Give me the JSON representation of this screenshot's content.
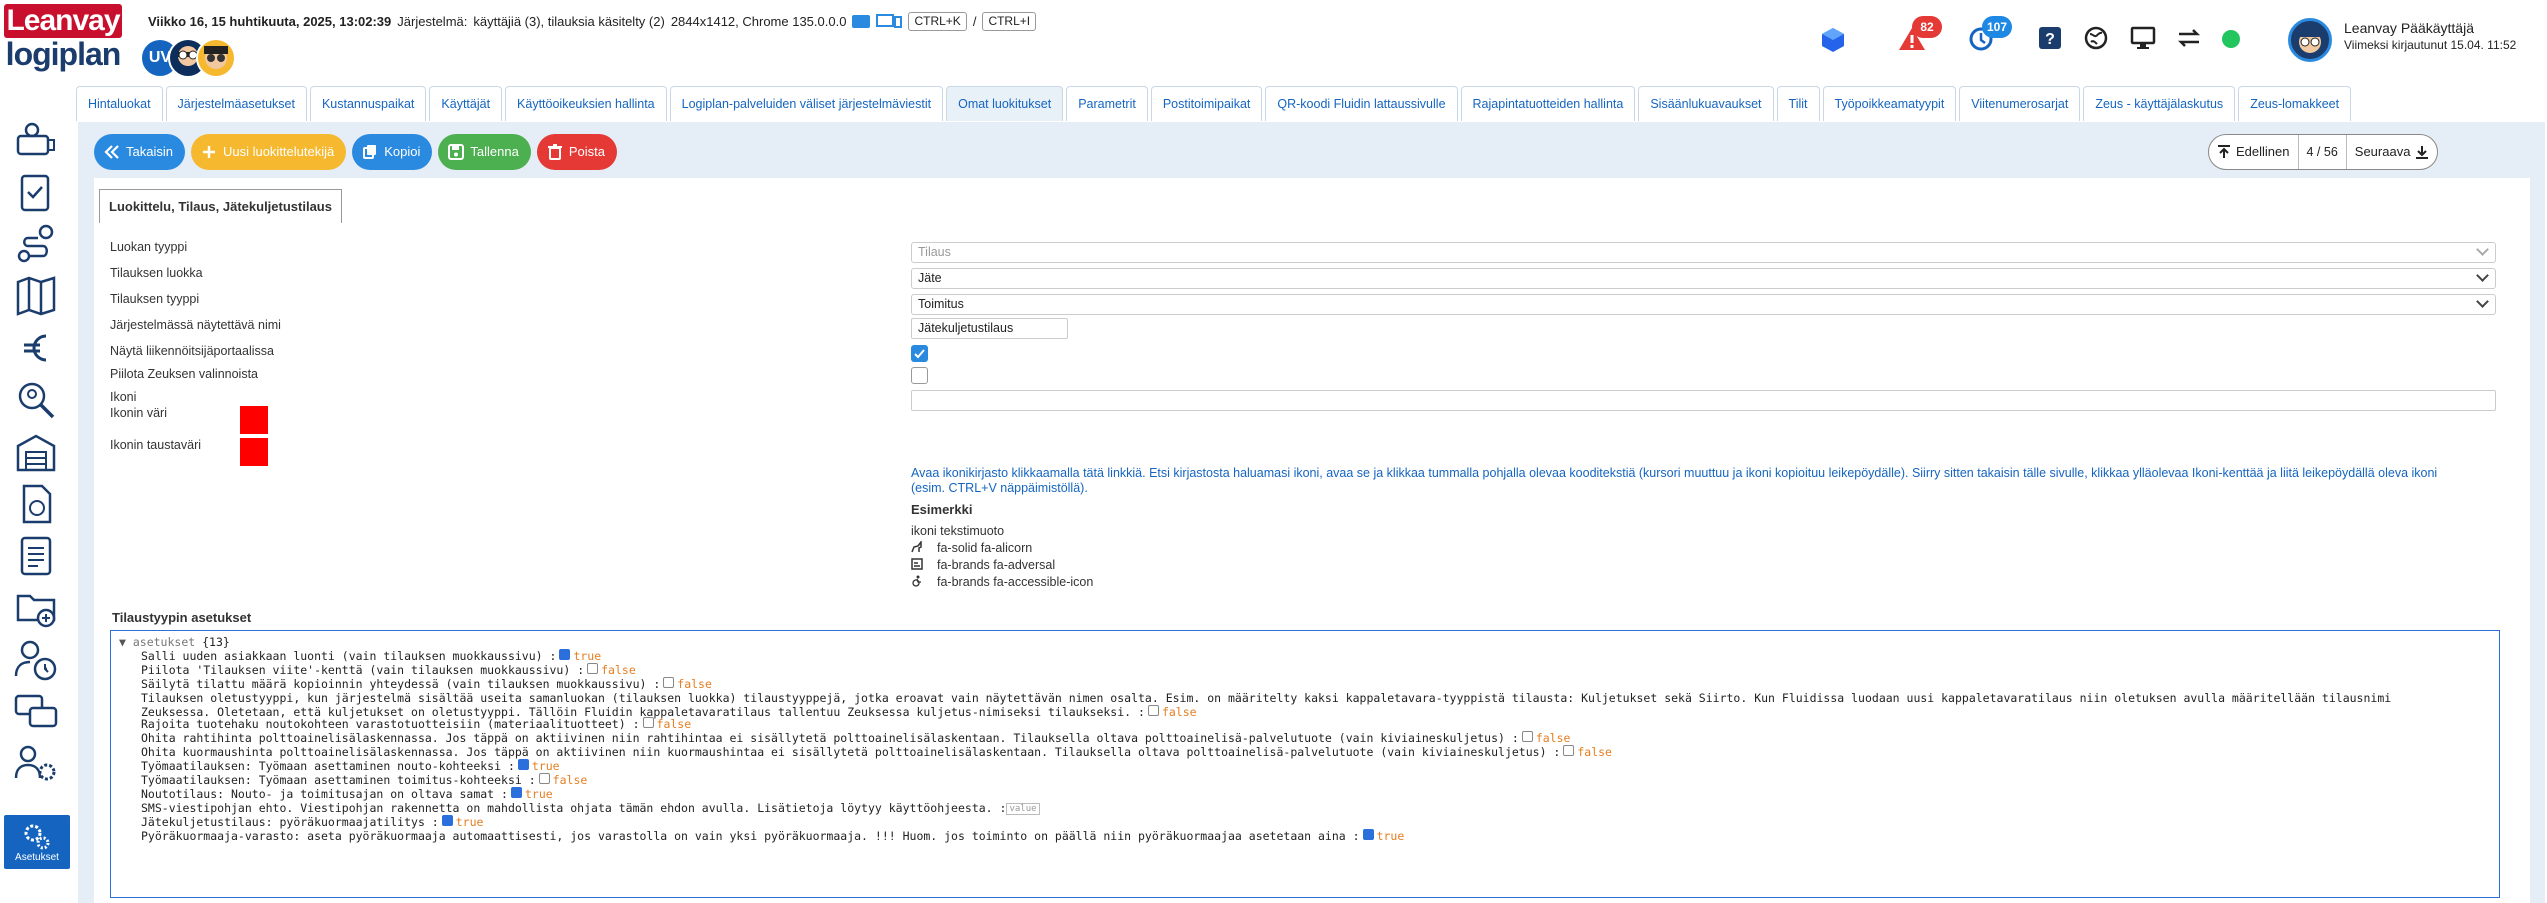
{
  "brand": {
    "top": "Leanvay",
    "bottom": "logiplan"
  },
  "status": {
    "week": "Viikko 16, 15 huhtikuuta, 2025, 13:02:39",
    "system_label": "Järjestelmä:",
    "system_value": "käyttäjiä (3), tilauksia käsitelty (2)",
    "resolution": "2844x1412, Chrome 135.0.0.0",
    "shortcut1": "CTRL+K",
    "sep": "/",
    "shortcut2": "CTRL+I"
  },
  "avatars": [
    {
      "initials": "UV"
    },
    {
      "initials": ""
    },
    {
      "initials": ""
    }
  ],
  "notifications": {
    "alerts": "82",
    "updates": "107"
  },
  "user": {
    "name": "Leanvay Pääkäyttäjä",
    "last_login": "Viimeksi kirjautunut 15.04. 11:52"
  },
  "sidebar": {
    "active_label": "Asetukset"
  },
  "tabs": [
    "Hintaluokat",
    "Järjestelmäasetukset",
    "Kustannuspaikat",
    "Käyttäjät",
    "Käyttöoikeuksien hallinta",
    "Logiplan-palveluiden väliset järjestelmäviestit",
    "Omat luokitukset",
    "Parametrit",
    "Postitoimipaikat",
    "QR-koodi Fluidin lattaussivulle",
    "Rajapintatuotteiden hallinta",
    "Sisäänlukuavaukset",
    "Tilit",
    "Työpoikkeamatyypit",
    "Viitenumerosarjat",
    "Zeus - käyttäjälaskutus",
    "Zeus-lomakkeet"
  ],
  "active_tab": "Omat luokitukset",
  "toolbar": {
    "back": "Takaisin",
    "new_classifier": "Uusi luokittelutekijä",
    "copy": "Kopioi",
    "save": "Tallenna",
    "delete": "Poista"
  },
  "pager": {
    "prev": "Edellinen",
    "count": "4 / 56",
    "next": "Seuraava"
  },
  "panel_tab": "Luokittelu, Tilaus, Jätekuljetustilaus",
  "form": {
    "class_type_label": "Luokan tyyppi",
    "class_type_value": "Tilaus",
    "order_class_label": "Tilauksen luokka",
    "order_class_value": "Jäte",
    "order_type_label": "Tilauksen tyyppi",
    "order_type_value": "Toimitus",
    "display_name_label": "Järjestelmässä näytettävä nimi",
    "display_name_value": "Jätekuljetustilaus",
    "show_portal_label": "Näytä liikennöitsijäportaalissa",
    "show_portal_checked": true,
    "hide_zeus_label": "Piilota Zeuksen valinnoista",
    "hide_zeus_checked": false,
    "icon_label": "Ikoni",
    "icon_value": "",
    "icon_color_label": "Ikonin väri",
    "icon_color": "#ff0000",
    "icon_bg_label": "Ikonin taustaväri",
    "icon_bg": "#ff0000",
    "help_text": "Avaa ikonikirjasto klikkaamalla tätä linkkiä. Etsi kirjastosta haluamasi ikoni, avaa se ja klikkaa tummalla pohjalla olevaa kooditekstiä (kursori muuttuu ja ikoni kopioituu leikepöydälle). Siirry sitten takaisin tälle sivulle, klikkaa ylläolevaa Ikoni-kenttää ja liitä leikepöydällä oleva ikoni (esim. CTRL+V näppäimistöllä).",
    "examples_heading": "Esimerkki",
    "examples_format": "ikoni tekstimuoto",
    "examples": [
      "fa-solid fa-alicorn",
      "fa-brands fa-adversal",
      "fa-brands fa-accessible-icon"
    ]
  },
  "settings": {
    "heading": "Tilaustyypin asetukset",
    "root_key": "asetukset",
    "root_count": "{13}",
    "rows": [
      {
        "text": "Salli uuden asiakkaan luonti (vain tilauksen muokkaussivu)",
        "value": "true",
        "checked": true
      },
      {
        "text": "Piilota 'Tilauksen viite'-kenttä (vain tilauksen muokkaussivu)",
        "value": "false",
        "checked": false
      },
      {
        "text": "Säilytä tilattu määrä kopioinnin yhteydessä (vain tilauksen muokkaussivu)",
        "value": "false",
        "checked": false
      },
      {
        "text": "Tilauksen oletustyyppi, kun järjestelmä sisältää useita samanluokan (tilauksen luokka) tilaustyyppejä, jotka eroavat vain näytettävän nimen osalta. Esim. on määritelty kaksi kappaletavara-tyyppistä tilausta: Kuljetukset sekä Siirto. Kun Fluidissa luodaan uusi kappaletavaratilaus niin oletuksen avulla määritellään tilausnimi\nZeuksessa. Oletetaan, että kuljetukset on oletustyyppi. Tällöin Fluidin kappaletavaratilaus tallentuu Zeuksessa kuljetus-nimiseksi tilaukseksi.",
        "value": "false",
        "checked": false
      },
      {
        "text": "Rajoita tuotehaku noutokohteen varastotuotteisiin (materiaalituotteet)",
        "value": "false",
        "checked": false
      },
      {
        "text": "Ohita rahtihinta polttoainelisälaskennassa. Jos täppä on aktiivinen niin rahtihintaa ei sisällytetä polttoainelisälaskentaan. Tilauksella oltava polttoainelisä-palvelutuote (vain kiviaineskuljetus)",
        "value": "false",
        "checked": false
      },
      {
        "text": "Ohita kuormaushinta polttoainelisälaskennassa. Jos täppä on aktiivinen niin kuormaushintaa ei sisällytetä polttoainelisälaskentaan. Tilauksella oltava polttoainelisä-palvelutuote (vain kiviaineskuljetus)",
        "value": "false",
        "checked": false
      },
      {
        "text": "Työmaatilauksen: Työmaan asettaminen nouto-kohteeksi",
        "value": "true",
        "checked": true
      },
      {
        "text": "Työmaatilauksen: Työmaan asettaminen toimitus-kohteeksi",
        "value": "false",
        "checked": false
      },
      {
        "text": "Noutotilaus: Nouto- ja toimitusajan on oltava samat",
        "value": "true",
        "checked": true
      },
      {
        "text": "SMS-viestipohjan ehto. Viestipohjan rakennetta on mahdollista ohjata tämän ehdon avulla. Lisätietoja löytyy käyttöohjeesta.",
        "value": "value",
        "checked": null
      },
      {
        "text": "Jätekuljetustilaus: pyöräkuormaajatilitys",
        "value": "true",
        "checked": true
      },
      {
        "text": "Pyöräkuormaaja-varasto: aseta pyöräkuormaaja automaattisesti, jos varastolla on vain yksi pyöräkuormaaja. !!! Huom. jos toiminto on päällä niin pyöräkuormaajaa asetetaan aina",
        "value": "true",
        "checked": true
      }
    ]
  },
  "colors": {
    "accent": "#2a8adf",
    "danger": "#e53935",
    "warning": "#f5b82e",
    "success": "#4caf50",
    "brand_red": "#c8102e",
    "brand_blue": "#1b3d6d"
  }
}
